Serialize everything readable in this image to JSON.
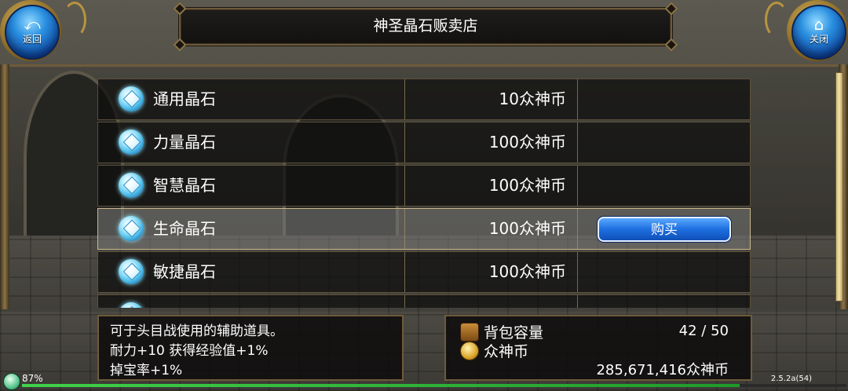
{
  "back_button": {
    "icon": "back-arrow-icon",
    "label": "返回"
  },
  "close_button": {
    "icon": "home-icon",
    "label": "关闭"
  },
  "title": "神圣晶石贩卖店",
  "shop": {
    "items": [
      {
        "name": "通用晶石",
        "price": "10众神币",
        "icon": "crystal-icon"
      },
      {
        "name": "力量晶石",
        "price": "100众神币",
        "icon": "crystal-icon"
      },
      {
        "name": "智慧晶石",
        "price": "100众神币",
        "icon": "crystal-icon"
      },
      {
        "name": "生命晶石",
        "price": "100众神币",
        "icon": "crystal-icon",
        "selected": true
      },
      {
        "name": "敏捷晶石",
        "price": "100众神币",
        "icon": "crystal-icon"
      }
    ],
    "buy_label": "购买"
  },
  "description": {
    "lines": [
      "可于头目战使用的辅助道具。",
      "耐力+10 获得经验值+1%",
      "掉宝率+1%"
    ]
  },
  "inventory": {
    "bag_label": "背包容量",
    "bag_value": "42 / 50",
    "currency_label": "众神币",
    "currency_value": "285,671,416众神币"
  },
  "status": {
    "percent": "87%",
    "version": "2.5.2a(54)",
    "exp_fraction": 0.87
  },
  "colors": {
    "accent_gold": "#8b7448",
    "button_blue": "#1e6fe0",
    "exp_green": "#3fd24a"
  }
}
